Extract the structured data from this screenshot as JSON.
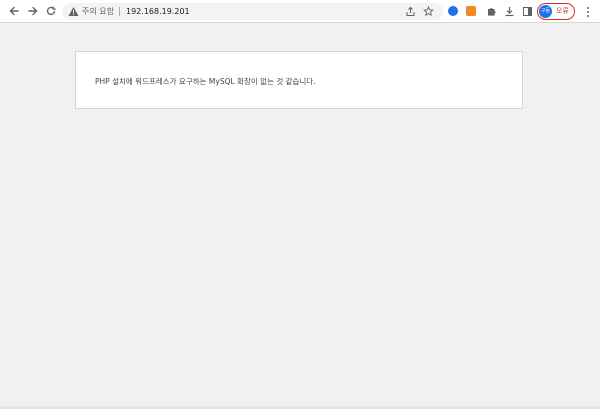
{
  "toolbar": {
    "security_warning": "주의 요함",
    "url": "192.168.19.201",
    "profile": {
      "avatar_text": "구동",
      "label": "오류"
    }
  },
  "extensions": [
    {
      "name": "extension-blue-icon",
      "color": "#1a73e8",
      "text": ""
    },
    {
      "name": "extension-orange-icon",
      "color": "#f08a24",
      "text": ""
    }
  ],
  "colors": {
    "page_background": "#f1f1f1",
    "warning": "#d93025"
  },
  "page": {
    "message": "PHP 설치에 워드프레스가 요구하는 MySQL 확장이 없는 것 같습니다."
  }
}
